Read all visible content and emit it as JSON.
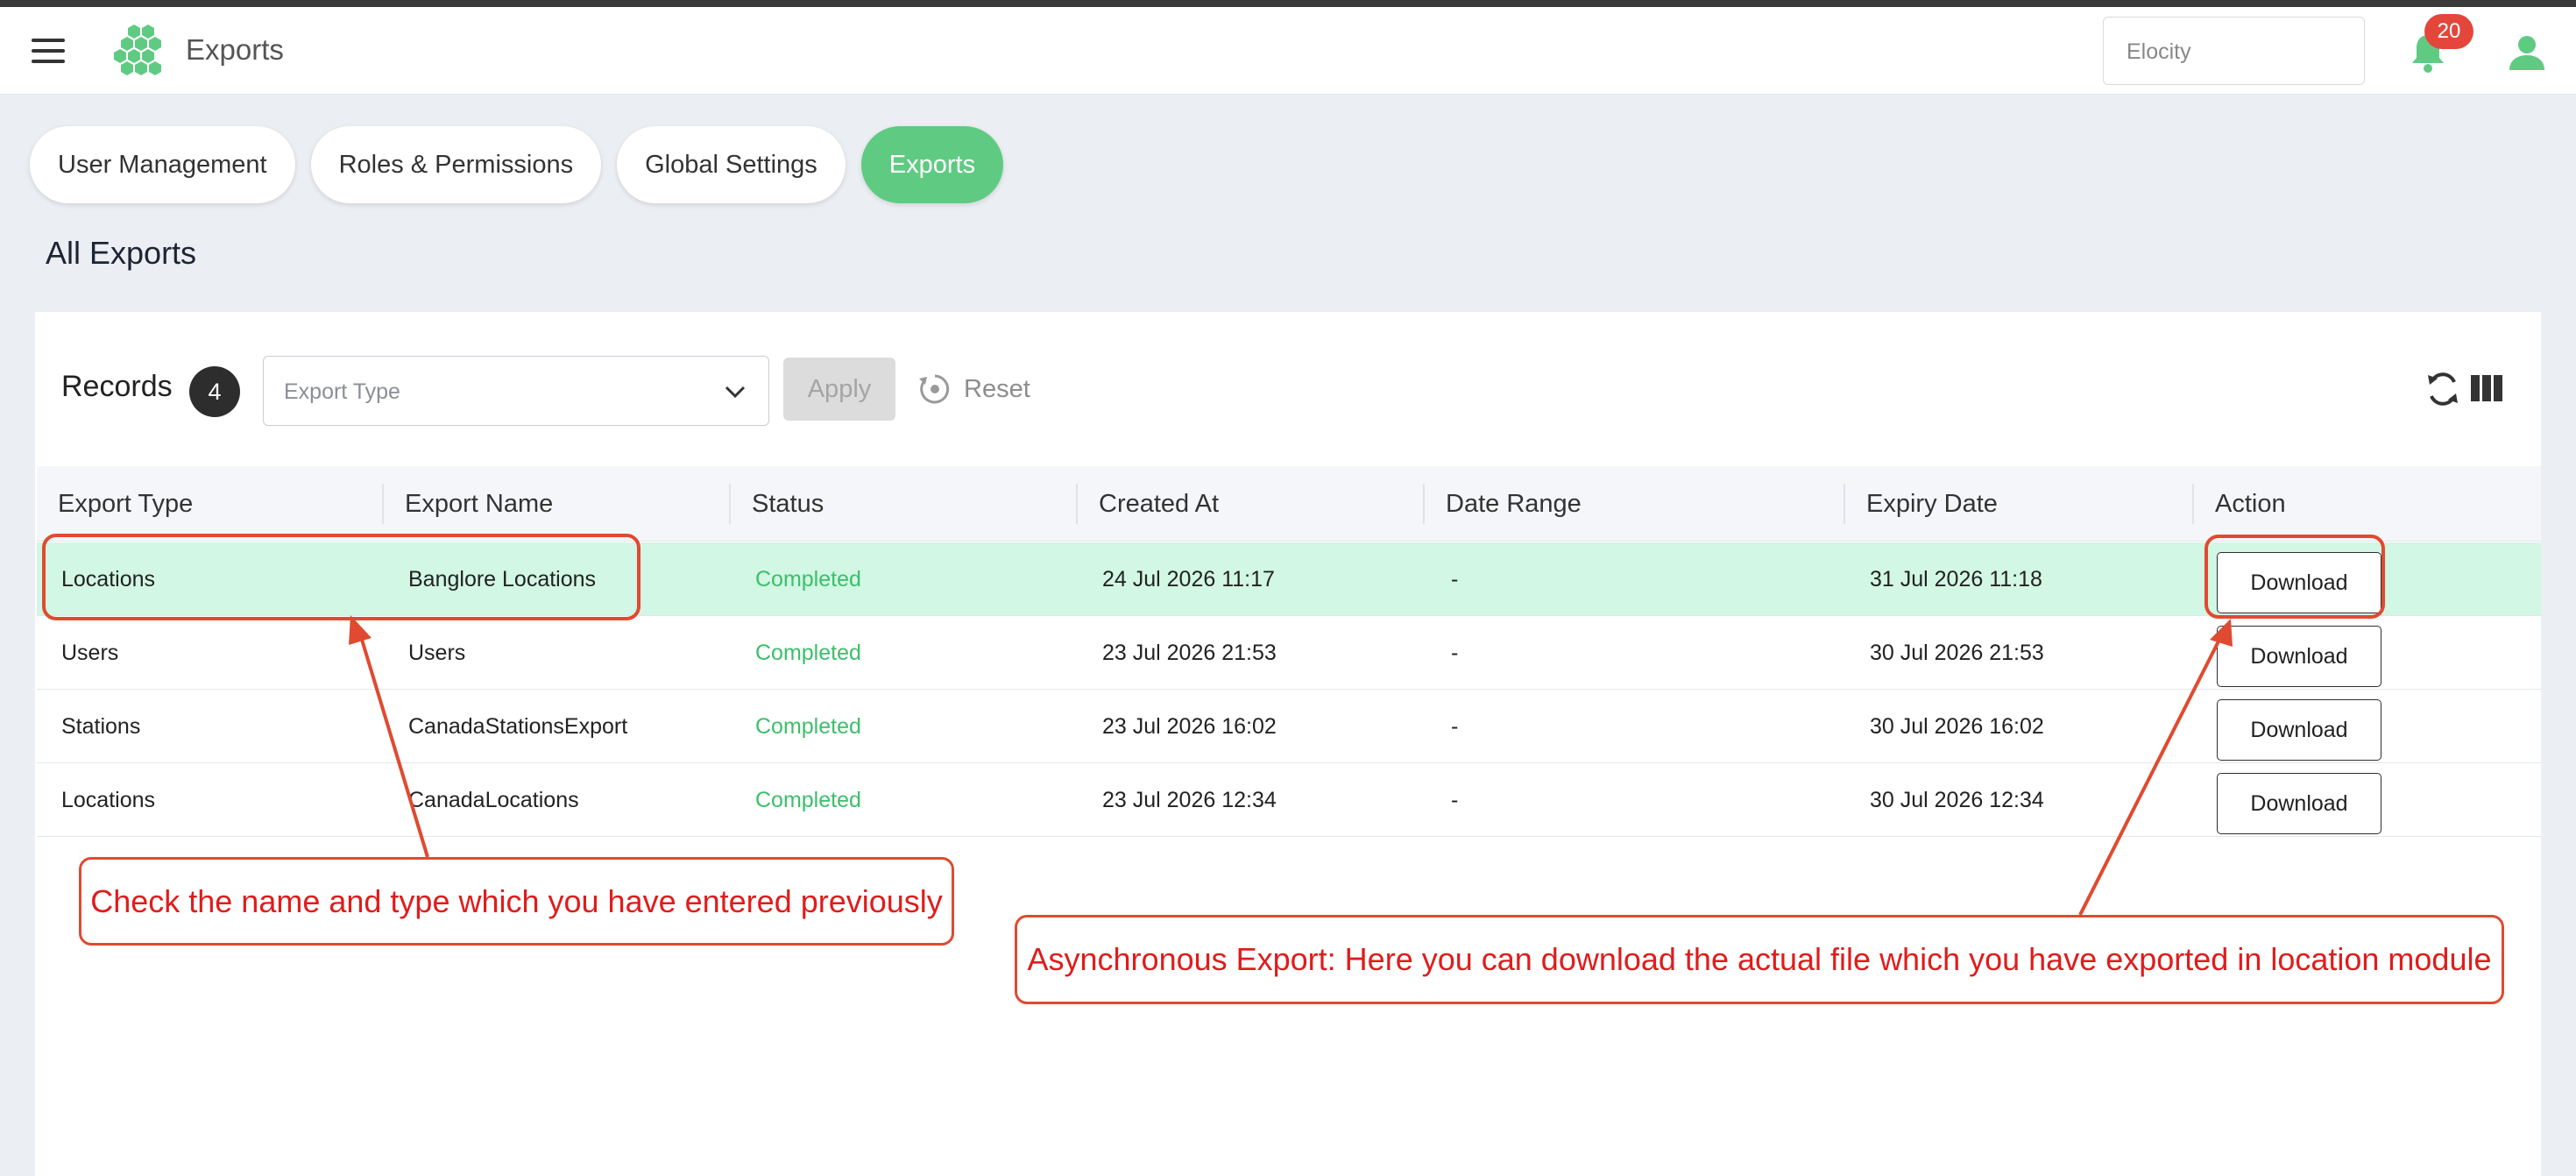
{
  "header": {
    "title": "Exports",
    "org_placeholder": "Elocity",
    "notification_count": "20"
  },
  "tabs": [
    {
      "label": "User Management",
      "active": false
    },
    {
      "label": "Roles & Permissions",
      "active": false
    },
    {
      "label": "Global Settings",
      "active": false
    },
    {
      "label": "Exports",
      "active": true
    }
  ],
  "page": {
    "title": "All Exports"
  },
  "toolbar": {
    "records_label": "Records",
    "records_count": "4",
    "export_type_placeholder": "Export Type",
    "apply_label": "Apply",
    "reset_label": "Reset"
  },
  "table": {
    "columns": [
      "Export Type",
      "Export Name",
      "Status",
      "Created At",
      "Date Range",
      "Expiry Date",
      "Action"
    ],
    "rows": [
      {
        "type": "Locations",
        "name": "Banglore Locations",
        "status": "Completed",
        "created": "24 Jul 2026 11:17",
        "range": "-",
        "expiry": "31 Jul 2026 11:18",
        "action": "Download"
      },
      {
        "type": "Users",
        "name": "Users",
        "status": "Completed",
        "created": "23 Jul 2026 21:53",
        "range": "-",
        "expiry": "30 Jul 2026 21:53",
        "action": "Download"
      },
      {
        "type": "Stations",
        "name": "CanadaStationsExport",
        "status": "Completed",
        "created": "23 Jul 2026 16:02",
        "range": "-",
        "expiry": "30 Jul 2026 16:02",
        "action": "Download"
      },
      {
        "type": "Locations",
        "name": "CanadaLocations",
        "status": "Completed",
        "created": "23 Jul 2026 12:34",
        "range": "-",
        "expiry": "30 Jul 2026 12:34",
        "action": "Download"
      }
    ]
  },
  "annotations": {
    "left_callout": "Check the name and type which you have entered previously",
    "right_callout": "Asynchronous Export: Here you can download the actual file which you have exported in location module"
  },
  "colors": {
    "brand_green": "#5fcb82",
    "status_green": "#3cbf6a",
    "highlight_row": "#d2f7e4",
    "badge_red": "#e4463c",
    "annotation_red": "#e04a30"
  }
}
